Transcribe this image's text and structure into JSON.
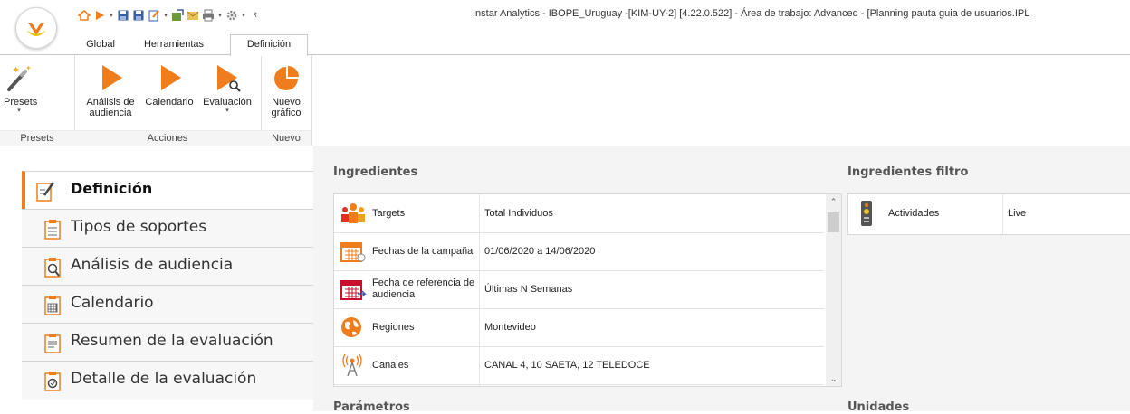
{
  "app": {
    "window_title": "Instar Analytics - IBOPE_Uruguay -[KIM-UY-2]  [4.22.0.522] - Área de trabajo: Advanced - [Planning pauta guia de usuarios.IPL"
  },
  "ribbon": {
    "tabs": [
      {
        "label": "Global"
      },
      {
        "label": "Herramientas"
      },
      {
        "label": "Definición",
        "active": true
      }
    ],
    "groups": {
      "presets": {
        "label": "Presets",
        "button": "Presets"
      },
      "acciones": {
        "label": "Acciones",
        "buttons": [
          {
            "label_1": "Análisis de",
            "label_2": "audiencia"
          },
          {
            "label_1": "Calendario"
          },
          {
            "label_1": "Evaluación"
          }
        ]
      },
      "nuevo": {
        "label": "Nuevo",
        "button_1": "Nuevo",
        "button_2": "gráfico"
      }
    }
  },
  "nav": {
    "items": [
      {
        "label": "Definición",
        "icon": "edit-document-icon",
        "active": true
      },
      {
        "label": "Tipos de soportes",
        "icon": "list-document-icon"
      },
      {
        "label": "Análisis de audiencia",
        "icon": "audience-search-icon"
      },
      {
        "label": "Calendario",
        "icon": "calendar-icon"
      },
      {
        "label": "Resumen de la evaluación",
        "icon": "summary-document-icon"
      },
      {
        "label": "Detalle de la evaluación",
        "icon": "detail-search-icon"
      }
    ]
  },
  "main": {
    "ingredientes_title": "Ingredientes",
    "ingredientes": [
      {
        "key": "Targets",
        "value": "Total Individuos",
        "icon": "people-icon"
      },
      {
        "key": "Fechas de la campaña",
        "value": "01/06/2020 a 14/06/2020",
        "icon": "calendar-range-icon"
      },
      {
        "key": "Fecha de referencia de audiencia",
        "value": "Últimas N Semanas",
        "icon": "calendar-reference-icon"
      },
      {
        "key": "Regiones",
        "value": "Montevideo",
        "icon": "globe-icon"
      },
      {
        "key": "Canales",
        "value": "CANAL 4, 10 SAETA, 12 TELEDOCE",
        "icon": "antenna-icon"
      }
    ],
    "filtro_title": "Ingredientes filtro",
    "filtro": [
      {
        "key": "Actividades",
        "value": "Live",
        "icon": "remote-control-icon"
      }
    ],
    "parametros_title": "Parámetros",
    "unidades_title": "Unidades"
  },
  "colors": {
    "accent": "#f07d1b",
    "nav_active_bar": "#f07d1b"
  }
}
